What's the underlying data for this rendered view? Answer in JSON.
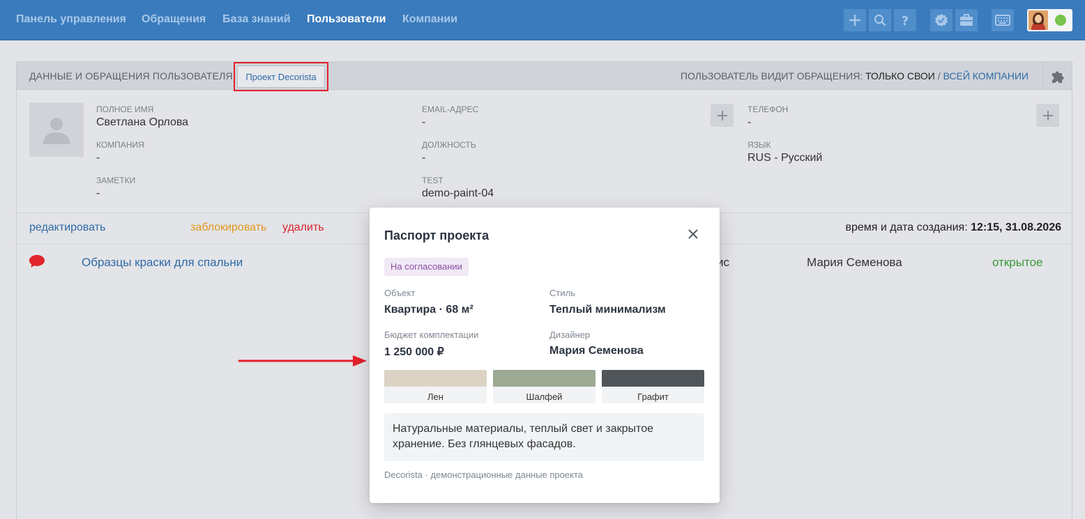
{
  "nav": {
    "items": [
      "Панель управления",
      "Обращения",
      "База знаний",
      "Пользователи",
      "Компании"
    ],
    "active_index": 3
  },
  "toolbar": {
    "icons": [
      "plus-icon",
      "search-icon",
      "help-icon",
      "verified-icon",
      "briefcase-icon",
      "keyboard-icon"
    ],
    "user_status_color": "#79c34e"
  },
  "panel": {
    "title": "ДАННЫЕ И ОБРАЩЕНИЯ ПОЛЬЗОВАТЕЛЯ",
    "project_tag": "Проект Decorista",
    "visibility_label": "ПОЛЬЗОВАТЕЛЬ ВИДИТ ОБРАЩЕНИЯ:",
    "visibility_current": "ТОЛЬКО СВОИ",
    "visibility_separator": "/",
    "visibility_other": "ВСЕЙ КОМПАНИИ"
  },
  "user": {
    "full_name_label": "ПОЛНОЕ ИМЯ",
    "full_name": "Светлана Орлова",
    "company_label": "КОМПАНИЯ",
    "company": "-",
    "notes_label": "ЗАМЕТКИ",
    "notes": "-",
    "email_label": "EMAIL-АДРЕС",
    "email": "-",
    "position_label": "ДОЛЖНОСТЬ",
    "position": "-",
    "test_label": "TEST",
    "test": "demo-paint-04",
    "phone_label": "ТЕЛЕФОН",
    "phone": "-",
    "language_label": "ЯЗЫК",
    "language": "RUS - Русский"
  },
  "actions": {
    "edit": "редактировать",
    "block": "заблокировать",
    "delete": "удалить",
    "created_label": "время и дата создания:",
    "created_value": "12:15, 31.08.2026"
  },
  "ticket": {
    "title": "Образцы краски для спальни",
    "truncated_text": "ис",
    "assignee": "Мария Семенова",
    "status": "открытое"
  },
  "modal": {
    "title": "Паспорт проекта",
    "status": "На согласовании",
    "object_label": "Объект",
    "object": "Квартира · 68 м²",
    "style_label": "Стиль",
    "style": "Теплый минимализм",
    "budget_label": "Бюджет комплектации",
    "budget": "1 250 000 ₽",
    "designer_label": "Дизайнер",
    "designer": "Мария Семенова",
    "swatches": [
      {
        "name": "Лен",
        "color": "#dcd3c5"
      },
      {
        "name": "Шалфей",
        "color": "#9ea994"
      },
      {
        "name": "Графит",
        "color": "#4f5559"
      }
    ],
    "note": "Натуральные материалы, теплый свет и закрытое хранение. Без глянцевых фасадов.",
    "footer": "Decorista · демонстрационные данные проекта"
  },
  "colors": {
    "topbar": "#3a7bbd",
    "link": "#2f6aa6",
    "block_link": "#e0981f",
    "delete_link": "#d9232b",
    "status_open": "#3a9a3a",
    "highlight": "#e3202a"
  }
}
